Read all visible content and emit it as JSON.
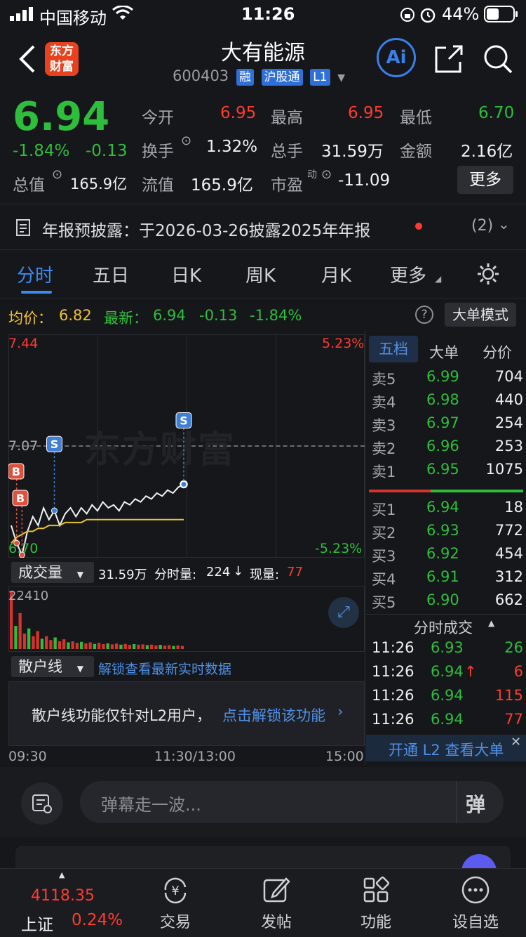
{
  "status_bar": {
    "carrier": "中国移动",
    "time": "11:26",
    "battery": "44%"
  },
  "header": {
    "logo_line1": "东方",
    "logo_line2": "财富",
    "title": "大有能源",
    "code": "600403",
    "tags": [
      "融",
      "沪股通",
      "L1"
    ],
    "ai_label": "Ai"
  },
  "quote": {
    "price": "6.94",
    "change_pct": "-1.84%",
    "change": "-0.13",
    "open_label": "今开",
    "open": "6.95",
    "high_label": "最高",
    "high": "6.95",
    "low_label": "最低",
    "low": "6.70",
    "turnover_label": "换手",
    "turnover": "1.32%",
    "volume_label": "总手",
    "volume": "31.59万",
    "amount_label": "金额",
    "amount": "2.16亿",
    "mktcap_label": "总值",
    "mktcap": "165.9亿",
    "float_label": "流值",
    "float": "165.9亿",
    "pe_label": "市盈",
    "pe_sup": "动",
    "pe": "-11.09",
    "more_button": "更多"
  },
  "notice": {
    "text": "年报预披露：于2026-03-26披露2025年年报",
    "count": "(2)"
  },
  "tabs": [
    "分时",
    "五日",
    "日K",
    "周K",
    "月K",
    "更多"
  ],
  "chart_header": {
    "avg_label": "均价：",
    "avg": "6.82",
    "latest_label": "最新：",
    "latest": "6.94",
    "latest_change": "-0.13",
    "latest_pct": "-1.84%",
    "mode_button": "大单模式"
  },
  "chart_data": {
    "type": "line",
    "y_top": "7.44",
    "y_bottom": "6.70",
    "pct_top": "5.23%",
    "pct_bottom": "-5.23%",
    "ref_line": "7.07",
    "ylim": [
      6.7,
      7.44
    ],
    "series": [
      {
        "values": [
          6.8,
          6.74,
          6.7,
          6.78,
          6.83,
          6.8,
          6.86,
          6.82,
          6.85,
          6.8,
          6.84,
          6.86,
          6.83,
          6.86,
          6.84,
          6.87,
          6.85,
          6.88,
          6.86,
          6.87,
          6.85,
          6.88,
          6.87,
          6.89,
          6.88,
          6.9,
          6.89,
          6.91,
          6.9,
          6.92,
          6.91,
          6.93,
          6.94
        ]
      },
      {
        "values": [
          6.74,
          6.76,
          6.77,
          6.78,
          6.78,
          6.79,
          6.79,
          6.8,
          6.8,
          6.8,
          6.81,
          6.81,
          6.81,
          6.81,
          6.82,
          6.82,
          6.82,
          6.82,
          6.82,
          6.82,
          6.82,
          6.82,
          6.82,
          6.82,
          6.82,
          6.82,
          6.82,
          6.82,
          6.82,
          6.82,
          6.82,
          6.82,
          6.82
        ]
      }
    ],
    "markers": [
      {
        "label": "B",
        "type": "buy"
      },
      {
        "label": "B",
        "type": "buy"
      },
      {
        "label": "S",
        "type": "sell"
      },
      {
        "label": "S",
        "type": "sell"
      }
    ],
    "x_labels": [
      "09:30",
      "11:30/13:00",
      "15:00"
    ],
    "volume_max": "22410",
    "volumes": [
      22410,
      9000,
      14000,
      6000,
      8000,
      5000,
      7000,
      4000,
      5000,
      3500,
      4500,
      3000,
      3800,
      2600,
      3000,
      2400,
      2800,
      2200,
      2600,
      2000,
      2400,
      1900,
      2200,
      1800,
      2100,
      1700,
      2000,
      1600,
      1900,
      1700,
      1800,
      1500,
      1700,
      1400,
      1600,
      1300,
      1500,
      1200,
      1400,
      1200
    ]
  },
  "volume_bar": {
    "label": "成交量",
    "total": "31.59万",
    "period_label": "分时量:",
    "period": "224",
    "now_label": "现量:",
    "now": "77"
  },
  "retail": {
    "label": "散户线",
    "unlock_link": "解锁查看最新实时数据",
    "msg": "散户线功能仅针对L2用户，",
    "msg_link": "点击解锁该功能"
  },
  "orderbook": {
    "tabs": [
      "五档",
      "大单",
      "分价"
    ],
    "asks": [
      {
        "label": "卖5",
        "price": "6.99",
        "qty": "704"
      },
      {
        "label": "卖4",
        "price": "6.98",
        "qty": "440"
      },
      {
        "label": "卖3",
        "price": "6.97",
        "qty": "254"
      },
      {
        "label": "卖2",
        "price": "6.96",
        "qty": "253"
      },
      {
        "label": "卖1",
        "price": "6.95",
        "qty": "1075"
      }
    ],
    "bids": [
      {
        "label": "买1",
        "price": "6.94",
        "qty": "18"
      },
      {
        "label": "买2",
        "price": "6.93",
        "qty": "772"
      },
      {
        "label": "买3",
        "price": "6.92",
        "qty": "454"
      },
      {
        "label": "买4",
        "price": "6.91",
        "qty": "312"
      },
      {
        "label": "买5",
        "price": "6.90",
        "qty": "662"
      }
    ],
    "ticks_title": "分时成交",
    "ticks": [
      {
        "time": "11:26",
        "price": "6.93",
        "qty": "26"
      },
      {
        "time": "11:26",
        "price": "6.94",
        "qty": "6"
      },
      {
        "time": "11:26",
        "price": "6.94",
        "qty": "115"
      },
      {
        "time": "11:26",
        "price": "6.94",
        "qty": "77"
      }
    ],
    "l2_banner": "开通 L2 查看大单"
  },
  "comment": {
    "placeholder": "弹幕走一波...",
    "danmu_label": "弹"
  },
  "bottom_nav": {
    "index_name": "上证",
    "index_value": "4118.35",
    "index_pct": "0.24%",
    "items": [
      "交易",
      "发帖",
      "功能",
      "设自选"
    ]
  }
}
